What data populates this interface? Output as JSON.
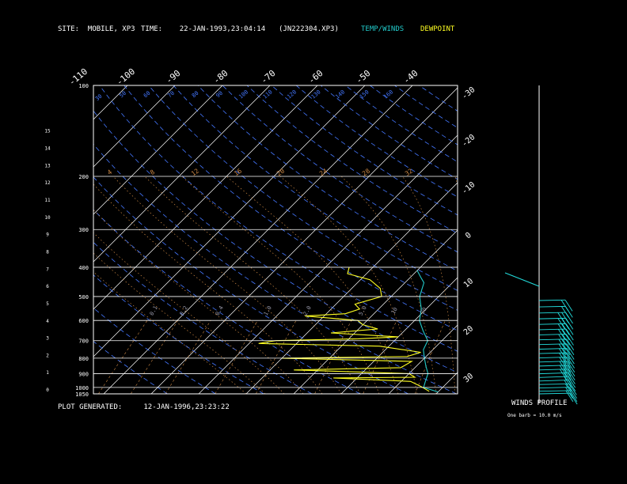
{
  "header": {
    "site": "SITE:  MOBILE, XP3",
    "time": "TIME:    22-JAN-1993,23:04:14",
    "file": "(JN222304.XP3)",
    "temp_winds": "TEMP/WINDS",
    "dewpoint": "DEWPOINT"
  },
  "footer": {
    "plot_generated": "PLOT GENERATED:     12-JAN-1996,23:23:22",
    "winds_profile": "WINDS PROFILE",
    "barb_note": "One barb = 10.0 m/s"
  },
  "colors": {
    "temperature": "#22cccc",
    "dewpoint": "#ffff22",
    "isotherm": "#ffffff",
    "dry_adiabat": "#4477ff",
    "moist_adiabat": "#cc8844",
    "mixing_ratio": "#cc8844",
    "barb": "#22dddd"
  },
  "chart_data": {
    "type": "line",
    "title": "",
    "pressure_labels": [
      "100",
      "200",
      "300",
      "400",
      "500",
      "600",
      "700",
      "800",
      "900",
      "1000",
      "1050"
    ],
    "height_labels_km": [
      "0",
      "1",
      "2",
      "3",
      "4",
      "5",
      "6",
      "7",
      "8",
      "9",
      "10",
      "11",
      "12",
      "13",
      "14",
      "15"
    ],
    "isotherm_top_labels": [
      "-110",
      "-100",
      "-90",
      "-80",
      "-70",
      "-60",
      "-50",
      "-40"
    ],
    "isotherm_right_labels": [
      "-30",
      "-20",
      "-10",
      "0",
      "10",
      "20",
      "30"
    ],
    "dry_adiabat_labels": [
      "30",
      "50",
      "60",
      "70",
      "80",
      "90",
      "100",
      "110",
      "120",
      "130",
      "140",
      "150",
      "160"
    ],
    "moist_adiabat_labels": [
      "4",
      "8",
      "12",
      "16",
      "20",
      "24",
      "28",
      "32"
    ],
    "mixing_ratio_labels": [
      "0.1",
      "0.2",
      "0.4",
      "1.0",
      "2.0",
      "5.0",
      "10",
      "20"
    ],
    "temperature_profile": {
      "name": "TEMP/WINDS",
      "points": [
        {
          "p": 1035,
          "t": 30
        },
        {
          "p": 1000,
          "t": 26
        },
        {
          "p": 950,
          "t": 25
        },
        {
          "p": 900,
          "t": 24
        },
        {
          "p": 850,
          "t": 22
        },
        {
          "p": 800,
          "t": 20
        },
        {
          "p": 750,
          "t": 18
        },
        {
          "p": 700,
          "t": 17
        },
        {
          "p": 650,
          "t": 14
        },
        {
          "p": 600,
          "t": 11
        },
        {
          "p": 550,
          "t": 9
        },
        {
          "p": 500,
          "t": 6
        },
        {
          "p": 450,
          "t": 4
        },
        {
          "p": 430,
          "t": 2
        },
        {
          "p": 410,
          "t": 0
        }
      ]
    },
    "dewpoint_profile": {
      "name": "DEWPOINT",
      "points": [
        {
          "p": 1030,
          "t": 28
        },
        {
          "p": 990,
          "t": 25
        },
        {
          "p": 955,
          "t": 22
        },
        {
          "p": 930,
          "t": 5
        },
        {
          "p": 925,
          "t": 22
        },
        {
          "p": 900,
          "t": 20
        },
        {
          "p": 875,
          "t": -5
        },
        {
          "p": 860,
          "t": 17
        },
        {
          "p": 820,
          "t": 18
        },
        {
          "p": 800,
          "t": -10
        },
        {
          "p": 790,
          "t": 16
        },
        {
          "p": 765,
          "t": 18
        },
        {
          "p": 730,
          "t": 8
        },
        {
          "p": 715,
          "t": -18
        },
        {
          "p": 700,
          "t": -15
        },
        {
          "p": 690,
          "t": 2
        },
        {
          "p": 680,
          "t": 10
        },
        {
          "p": 660,
          "t": -5
        },
        {
          "p": 640,
          "t": 4
        },
        {
          "p": 620,
          "t": 0
        },
        {
          "p": 600,
          "t": -2
        },
        {
          "p": 580,
          "t": -14
        },
        {
          "p": 570,
          "t": -6
        },
        {
          "p": 550,
          "t": -4
        },
        {
          "p": 530,
          "t": -6
        },
        {
          "p": 500,
          "t": -2
        },
        {
          "p": 470,
          "t": -4
        },
        {
          "p": 440,
          "t": -8
        },
        {
          "p": 420,
          "t": -14
        },
        {
          "p": 400,
          "t": -15
        }
      ]
    },
    "wind_barbs": [
      {
        "p": 1020,
        "speed_barbs": 1
      },
      {
        "p": 1000,
        "speed_barbs": 2
      },
      {
        "p": 975,
        "speed_barbs": 2
      },
      {
        "p": 950,
        "speed_barbs": 2
      },
      {
        "p": 925,
        "speed_barbs": 2
      },
      {
        "p": 900,
        "speed_barbs": 2
      },
      {
        "p": 875,
        "speed_barbs": 2
      },
      {
        "p": 850,
        "speed_barbs": 3
      },
      {
        "p": 825,
        "speed_barbs": 3
      },
      {
        "p": 800,
        "speed_barbs": 3
      },
      {
        "p": 775,
        "speed_barbs": 3
      },
      {
        "p": 750,
        "speed_barbs": 3
      },
      {
        "p": 725,
        "speed_barbs": 3
      },
      {
        "p": 700,
        "speed_barbs": 3
      },
      {
        "p": 675,
        "speed_barbs": 3
      },
      {
        "p": 650,
        "speed_barbs": 3
      },
      {
        "p": 625,
        "speed_barbs": 3
      },
      {
        "p": 600,
        "speed_barbs": 3
      },
      {
        "p": 575,
        "speed_barbs": 3
      },
      {
        "p": 550,
        "speed_barbs": 3
      },
      {
        "p": 525,
        "speed_barbs": 2
      },
      {
        "p": 500,
        "speed_barbs": 2
      }
    ]
  }
}
